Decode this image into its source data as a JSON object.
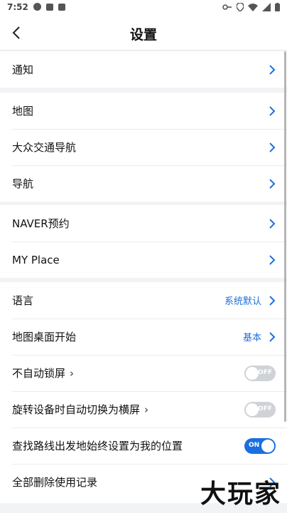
{
  "status": {
    "time": "7:52"
  },
  "header": {
    "title": "设置"
  },
  "sections": [
    {
      "items": [
        {
          "label": "通知"
        }
      ]
    },
    {
      "items": [
        {
          "label": "地图"
        },
        {
          "label": "大众交通导航"
        },
        {
          "label": "导航"
        }
      ]
    },
    {
      "items": [
        {
          "label": "NAVER预约"
        },
        {
          "label": "MY Place"
        }
      ]
    },
    {
      "items": [
        {
          "label": "语言",
          "value": "系统默认"
        },
        {
          "label": "地图桌面开始",
          "value": "基本"
        },
        {
          "label": "不自动锁屏",
          "toggle": "OFF"
        },
        {
          "label": "旋转设备时自动切换为横屏",
          "toggle": "OFF"
        },
        {
          "label": "查找路线出发地始终设置为我的位置",
          "toggle": "ON"
        },
        {
          "label": "全部删除使用记录"
        }
      ]
    }
  ],
  "watermark": "大玩家",
  "colors": {
    "accent": "#1a6fe0",
    "background": "#f2f3f5",
    "toggle_off": "#cfd2d7"
  }
}
